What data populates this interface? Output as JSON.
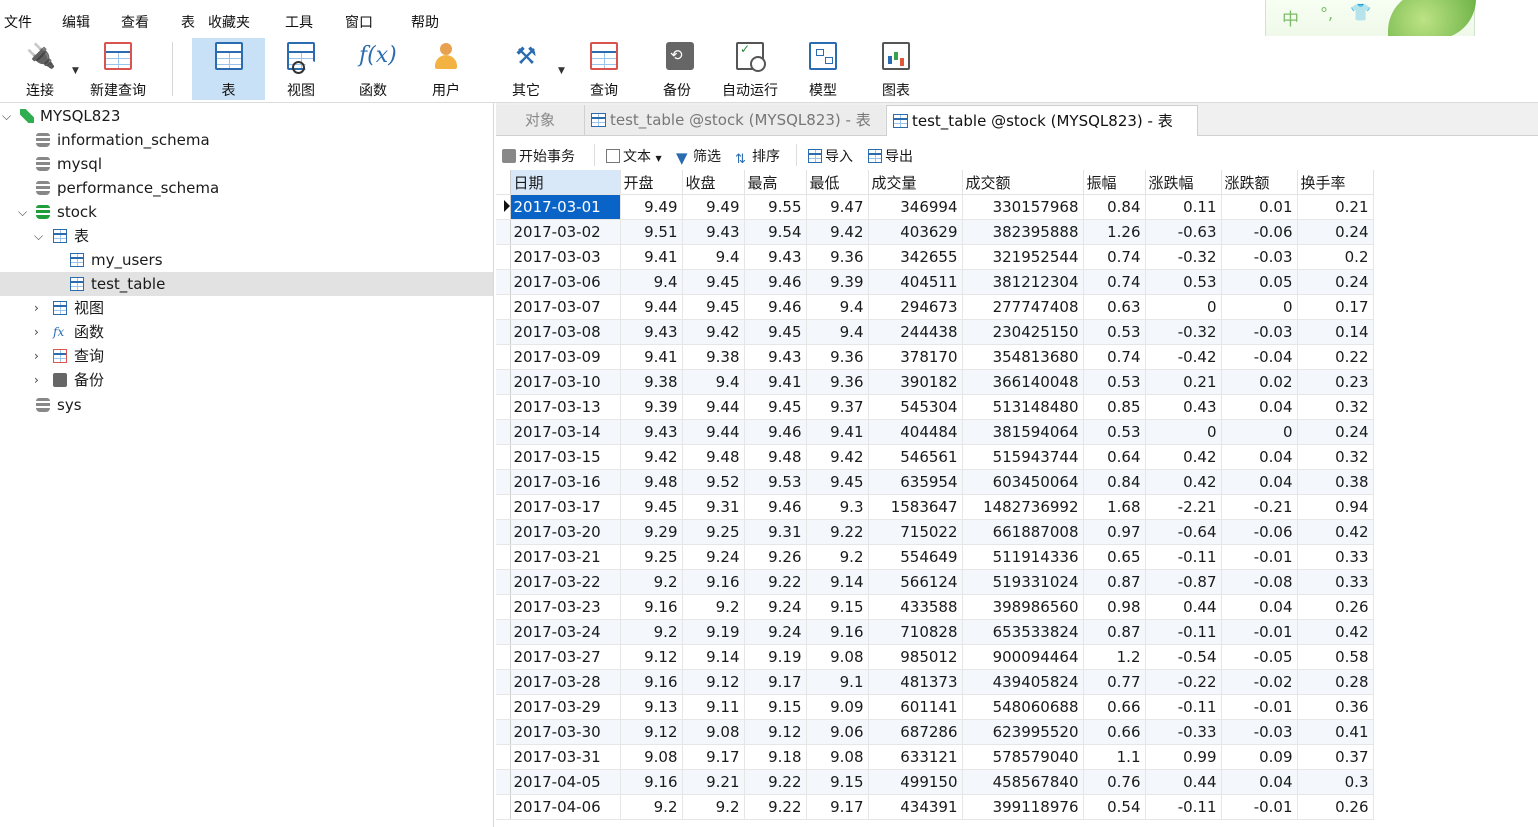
{
  "menu": [
    "文件",
    "编辑",
    "查看",
    "表",
    "收藏夹",
    "工具",
    "窗口",
    "帮助"
  ],
  "ime": {
    "char": "中",
    "dot": "°,",
    "shirt": "👕"
  },
  "toolbar": {
    "connect": "连接",
    "new_query": "新建查询",
    "table": "表",
    "view": "视图",
    "function": "函数",
    "user": "用户",
    "other": "其它",
    "query": "查询",
    "backup": "备份",
    "auto_run": "自动运行",
    "model": "模型",
    "chart": "图表",
    "fx_glyph": "f(x)"
  },
  "tree": {
    "connection": "MYSQL823",
    "databases": [
      "information_schema",
      "mysql",
      "performance_schema",
      "stock",
      "sys"
    ],
    "stock_children": {
      "tables_label": "表",
      "tables": [
        "my_users",
        "test_table"
      ],
      "views_label": "视图",
      "functions_label": "函数",
      "queries_label": "查询",
      "backups_label": "备份"
    },
    "selected": "test_table"
  },
  "tabs": {
    "objects": "对象",
    "inactive": "test_table @stock (MYSQL823) - 表",
    "active": "test_table @stock (MYSQL823) - 表"
  },
  "subtoolbar": {
    "begin_transaction": "开始事务",
    "text": "文本",
    "filter": "筛选",
    "sort": "排序",
    "import": "导入",
    "export": "导出"
  },
  "grid": {
    "columns": [
      "日期",
      "开盘",
      "收盘",
      "最高",
      "最低",
      "成交量",
      "成交额",
      "振幅",
      "涨跌幅",
      "涨跌额",
      "换手率"
    ],
    "rows": [
      [
        "2017-03-01",
        "9.49",
        "9.49",
        "9.55",
        "9.47",
        "346994",
        "330157968",
        "0.84",
        "0.11",
        "0.01",
        "0.21"
      ],
      [
        "2017-03-02",
        "9.51",
        "9.43",
        "9.54",
        "9.42",
        "403629",
        "382395888",
        "1.26",
        "-0.63",
        "-0.06",
        "0.24"
      ],
      [
        "2017-03-03",
        "9.41",
        "9.4",
        "9.43",
        "9.36",
        "342655",
        "321952544",
        "0.74",
        "-0.32",
        "-0.03",
        "0.2"
      ],
      [
        "2017-03-06",
        "9.4",
        "9.45",
        "9.46",
        "9.39",
        "404511",
        "381212304",
        "0.74",
        "0.53",
        "0.05",
        "0.24"
      ],
      [
        "2017-03-07",
        "9.44",
        "9.45",
        "9.46",
        "9.4",
        "294673",
        "277747408",
        "0.63",
        "0",
        "0",
        "0.17"
      ],
      [
        "2017-03-08",
        "9.43",
        "9.42",
        "9.45",
        "9.4",
        "244438",
        "230425150",
        "0.53",
        "-0.32",
        "-0.03",
        "0.14"
      ],
      [
        "2017-03-09",
        "9.41",
        "9.38",
        "9.43",
        "9.36",
        "378170",
        "354813680",
        "0.74",
        "-0.42",
        "-0.04",
        "0.22"
      ],
      [
        "2017-03-10",
        "9.38",
        "9.4",
        "9.41",
        "9.36",
        "390182",
        "366140048",
        "0.53",
        "0.21",
        "0.02",
        "0.23"
      ],
      [
        "2017-03-13",
        "9.39",
        "9.44",
        "9.45",
        "9.37",
        "545304",
        "513148480",
        "0.85",
        "0.43",
        "0.04",
        "0.32"
      ],
      [
        "2017-03-14",
        "9.43",
        "9.44",
        "9.46",
        "9.41",
        "404484",
        "381594064",
        "0.53",
        "0",
        "0",
        "0.24"
      ],
      [
        "2017-03-15",
        "9.42",
        "9.48",
        "9.48",
        "9.42",
        "546561",
        "515943744",
        "0.64",
        "0.42",
        "0.04",
        "0.32"
      ],
      [
        "2017-03-16",
        "9.48",
        "9.52",
        "9.53",
        "9.45",
        "635954",
        "603450064",
        "0.84",
        "0.42",
        "0.04",
        "0.38"
      ],
      [
        "2017-03-17",
        "9.45",
        "9.31",
        "9.46",
        "9.3",
        "1583647",
        "1482736992",
        "1.68",
        "-2.21",
        "-0.21",
        "0.94"
      ],
      [
        "2017-03-20",
        "9.29",
        "9.25",
        "9.31",
        "9.22",
        "715022",
        "661887008",
        "0.97",
        "-0.64",
        "-0.06",
        "0.42"
      ],
      [
        "2017-03-21",
        "9.25",
        "9.24",
        "9.26",
        "9.2",
        "554649",
        "511914336",
        "0.65",
        "-0.11",
        "-0.01",
        "0.33"
      ],
      [
        "2017-03-22",
        "9.2",
        "9.16",
        "9.22",
        "9.14",
        "566124",
        "519331024",
        "0.87",
        "-0.87",
        "-0.08",
        "0.33"
      ],
      [
        "2017-03-23",
        "9.16",
        "9.2",
        "9.24",
        "9.15",
        "433588",
        "398986560",
        "0.98",
        "0.44",
        "0.04",
        "0.26"
      ],
      [
        "2017-03-24",
        "9.2",
        "9.19",
        "9.24",
        "9.16",
        "710828",
        "653533824",
        "0.87",
        "-0.11",
        "-0.01",
        "0.42"
      ],
      [
        "2017-03-27",
        "9.12",
        "9.14",
        "9.19",
        "9.08",
        "985012",
        "900094464",
        "1.2",
        "-0.54",
        "-0.05",
        "0.58"
      ],
      [
        "2017-03-28",
        "9.16",
        "9.12",
        "9.17",
        "9.1",
        "481373",
        "439405824",
        "0.77",
        "-0.22",
        "-0.02",
        "0.28"
      ],
      [
        "2017-03-29",
        "9.13",
        "9.11",
        "9.15",
        "9.09",
        "601141",
        "548060688",
        "0.66",
        "-0.11",
        "-0.01",
        "0.36"
      ],
      [
        "2017-03-30",
        "9.12",
        "9.08",
        "9.12",
        "9.06",
        "687286",
        "623995520",
        "0.66",
        "-0.33",
        "-0.03",
        "0.41"
      ],
      [
        "2017-03-31",
        "9.08",
        "9.17",
        "9.18",
        "9.08",
        "633121",
        "578579040",
        "1.1",
        "0.99",
        "0.09",
        "0.37"
      ],
      [
        "2017-04-05",
        "9.16",
        "9.21",
        "9.22",
        "9.15",
        "499150",
        "458567840",
        "0.76",
        "0.44",
        "0.04",
        "0.3"
      ],
      [
        "2017-04-06",
        "9.2",
        "9.2",
        "9.22",
        "9.17",
        "434391",
        "399118976",
        "0.54",
        "-0.11",
        "-0.01",
        "0.26"
      ]
    ],
    "selected_row": 0
  },
  "colors": {
    "accent": "#0a64c8",
    "toolbar_active": "#c9e1f7",
    "selected_tree": "#e2e2e2"
  }
}
